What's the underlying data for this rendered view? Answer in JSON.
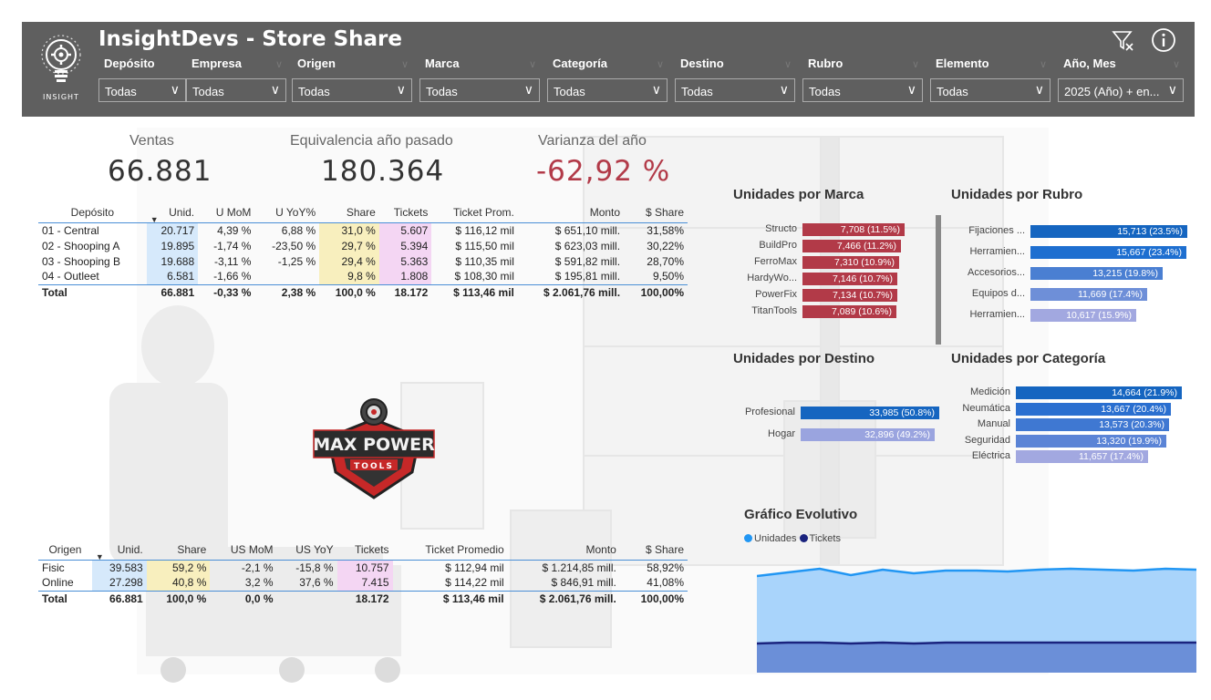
{
  "header": {
    "title": "InsightDevs - Store Share",
    "logo_text": "INSIGHT",
    "filters": [
      {
        "label": "Depósito",
        "value": "Todas"
      },
      {
        "label": "Empresa",
        "value": "Todas"
      },
      {
        "label": "Origen",
        "value": "Todas"
      },
      {
        "label": "Marca",
        "value": "Todas"
      },
      {
        "label": "Categoría",
        "value": "Todas"
      },
      {
        "label": "Destino",
        "value": "Todas"
      },
      {
        "label": "Rubro",
        "value": "Todas"
      },
      {
        "label": "Elemento",
        "value": "Todas"
      },
      {
        "label": "Año, Mes",
        "value": "2025 (Año) + en..."
      }
    ],
    "icons": [
      "clear-filter-icon",
      "info-icon"
    ]
  },
  "kpis": {
    "ventas": {
      "label": "Ventas",
      "value": "66.881"
    },
    "equivalencia": {
      "label": "Equivalencia año pasado",
      "value": "180.364"
    },
    "varianza": {
      "label": "Varianza del año",
      "value": "-62,92 %",
      "color": "#b23a48"
    }
  },
  "deposito_table": {
    "headers": [
      "Depósito",
      "Unid.",
      "U MoM",
      "U YoY%",
      "Share",
      "Tickets",
      "Ticket Prom.",
      "Monto",
      "$ Share"
    ],
    "rows": [
      [
        "01 - Central",
        "20.717",
        "4,39 %",
        "6,88 %",
        "31,0 %",
        "5.607",
        "$ 116,12 mil",
        "$ 651,10 mill.",
        "31,58%"
      ],
      [
        "02 - Shooping A",
        "19.895",
        "-1,74 %",
        "-23,50 %",
        "29,7 %",
        "5.394",
        "$ 115,50 mil",
        "$ 623,03 mill.",
        "30,22%"
      ],
      [
        "03 - Shooping B",
        "19.688",
        "-3,11 %",
        "-1,25 %",
        "29,4 %",
        "5.363",
        "$ 110,35 mil",
        "$ 591,82 mill.",
        "28,70%"
      ],
      [
        "04 - Outleet",
        "6.581",
        "-1,66 %",
        "",
        "9,8 %",
        "1.808",
        "$ 108,30 mil",
        "$ 195,81 mill.",
        "9,50%"
      ]
    ],
    "total": [
      "Total",
      "66.881",
      "-0,33 %",
      "2,38 %",
      "100,0 %",
      "18.172",
      "$ 113,46 mil",
      "$ 2.061,76 mill.",
      "100,00%"
    ]
  },
  "origen_table": {
    "headers": [
      "Origen",
      "Unid.",
      "Share",
      "US MoM",
      "US YoY",
      "Tickets",
      "Ticket Promedio",
      "Monto",
      "$ Share"
    ],
    "rows": [
      [
        "Fisic",
        "39.583",
        "59,2 %",
        "-2,1 %",
        "-15,8 %",
        "10.757",
        "$ 112,94 mil",
        "$ 1.214,85 mill.",
        "58,92%"
      ],
      [
        "Online",
        "27.298",
        "40,8 %",
        "3,2 %",
        "37,6 %",
        "7.415",
        "$ 114,22 mil",
        "$ 846,91 mill.",
        "41,08%"
      ]
    ],
    "total": [
      "Total",
      "66.881",
      "100,0 %",
      "0,0 %",
      "",
      "18.172",
      "$ 113,46 mil",
      "$ 2.061,76 mill.",
      "100,00%"
    ]
  },
  "brand_logo": {
    "line1": "MAX POWER",
    "line2": "TOOLS"
  },
  "charts": {
    "marca": {
      "title": "Unidades por Marca",
      "color": "#b23a48",
      "categories": [
        "Structo",
        "BuildPro",
        "FerroMax",
        "HardyWo...",
        "PowerFix",
        "TitanTools"
      ],
      "values": [
        7708,
        7466,
        7310,
        7146,
        7134,
        7089
      ],
      "labels": [
        "7,708 (11.5%)",
        "7,466 (11.2%)",
        "7,310 (10.9%)",
        "7,146 (10.7%)",
        "7,134 (10.7%)",
        "7,089 (10.6%)"
      ]
    },
    "rubro": {
      "title": "Unidades por Rubro",
      "colors": [
        "#1565c0",
        "#1e6fd0",
        "#4a7fd2",
        "#6e8fd8",
        "#a2a8e0"
      ],
      "categories": [
        "Fijaciones ...",
        "Herramien...",
        "Accesorios...",
        "Equipos d...",
        "Herramien..."
      ],
      "values": [
        15713,
        15667,
        13215,
        11669,
        10617
      ],
      "labels": [
        "15,713 (23.5%)",
        "15,667 (23.4%)",
        "13,215 (19.8%)",
        "11,669 (17.4%)",
        "10,617 (15.9%)"
      ]
    },
    "destino": {
      "title": "Unidades por Destino",
      "colors": [
        "#1565c0",
        "#9aa4df"
      ],
      "categories": [
        "Profesional",
        "Hogar"
      ],
      "values": [
        33985,
        32896
      ],
      "labels": [
        "33,985 (50.8%)",
        "32,896 (49.2%)"
      ]
    },
    "categoria": {
      "title": "Unidades por Categoría",
      "colors": [
        "#1565c0",
        "#2a6fd0",
        "#3f78d2",
        "#5b84d6",
        "#a2a8e0"
      ],
      "categories": [
        "Medición",
        "Neumática",
        "Manual",
        "Seguridad",
        "Eléctrica"
      ],
      "values": [
        14664,
        13667,
        13573,
        13320,
        11657
      ],
      "labels": [
        "14,664 (21.9%)",
        "13,667 (20.4%)",
        "13,573 (20.3%)",
        "13,320 (19.9%)",
        "11,657 (17.4%)"
      ]
    }
  },
  "evolutivo": {
    "title": "Gráfico Evolutivo",
    "legend": [
      {
        "name": "Unidades",
        "color": "#2196f3"
      },
      {
        "name": "Tickets",
        "color": "#1a237e"
      }
    ],
    "unidades_level": [
      0.9,
      0.93,
      0.97,
      0.91,
      0.96,
      0.92,
      0.95,
      0.95,
      0.94,
      0.96,
      0.97,
      0.96,
      0.95,
      0.97,
      0.96
    ],
    "tickets_level": [
      0.27,
      0.28,
      0.28,
      0.27,
      0.28,
      0.27,
      0.28,
      0.28,
      0.28,
      0.28,
      0.28,
      0.28,
      0.28,
      0.28,
      0.28
    ]
  }
}
